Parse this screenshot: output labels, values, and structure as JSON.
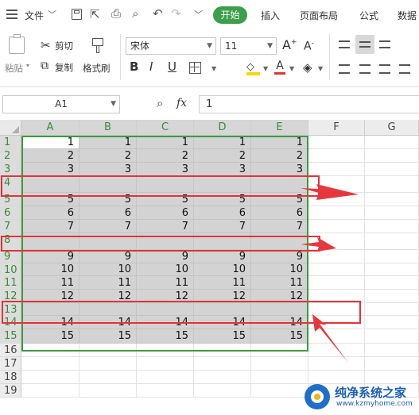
{
  "menu": {
    "file_label": "文件",
    "tabs": [
      "开始",
      "插入",
      "页面布局",
      "公式",
      "数据"
    ]
  },
  "ribbon": {
    "paste_label": "粘贴",
    "cut_label": "剪切",
    "copy_label": "复制",
    "format_painter_label": "格式刷",
    "font_name": "宋体",
    "font_size": "11",
    "font_color": "#e0343a",
    "fill_color": "#f5d800"
  },
  "formula_bar": {
    "name_box": "A1",
    "fx_label": "fx",
    "content": "1"
  },
  "columns": [
    "A",
    "B",
    "C",
    "D",
    "E",
    "F",
    "G"
  ],
  "rows": [
    {
      "label": "1",
      "values": [
        "1",
        "1",
        "1",
        "1",
        "1"
      ]
    },
    {
      "label": "2",
      "values": [
        "2",
        "2",
        "2",
        "2",
        "2"
      ]
    },
    {
      "label": "3",
      "values": [
        "3",
        "3",
        "3",
        "3",
        "3"
      ]
    },
    {
      "label": "4",
      "values": [
        "",
        "",
        "",
        "",
        ""
      ]
    },
    {
      "label": "5",
      "values": [
        "5",
        "5",
        "5",
        "5",
        "5"
      ]
    },
    {
      "label": "6",
      "values": [
        "6",
        "6",
        "6",
        "6",
        "6"
      ]
    },
    {
      "label": "7",
      "values": [
        "7",
        "7",
        "7",
        "7",
        "7"
      ]
    },
    {
      "label": "8",
      "values": [
        "",
        "",
        "",
        "",
        ""
      ]
    },
    {
      "label": "9",
      "values": [
        "9",
        "9",
        "9",
        "9",
        "9"
      ]
    },
    {
      "label": "10",
      "values": [
        "10",
        "10",
        "10",
        "10",
        "10"
      ]
    },
    {
      "label": "11",
      "values": [
        "11",
        "11",
        "11",
        "11",
        "11"
      ]
    },
    {
      "label": "12",
      "values": [
        "12",
        "12",
        "12",
        "12",
        "12"
      ]
    },
    {
      "label": "13",
      "values": [
        "",
        "",
        "",
        "",
        ""
      ]
    },
    {
      "label": "14",
      "values": [
        "14",
        "14",
        "14",
        "14",
        "14"
      ]
    },
    {
      "label": "15",
      "values": [
        "15",
        "15",
        "15",
        "15",
        "15"
      ]
    },
    {
      "label": "16",
      "values": []
    },
    {
      "label": "17",
      "values": []
    },
    {
      "label": "18",
      "values": []
    },
    {
      "label": "19",
      "values": []
    }
  ],
  "watermark": {
    "title": "纯净系统之家",
    "url": "www.kzmyhome.com"
  },
  "colors": {
    "accent_green": "#3c9e4c",
    "selection_border": "#3f9a42",
    "annotation_red": "#e0343a"
  }
}
